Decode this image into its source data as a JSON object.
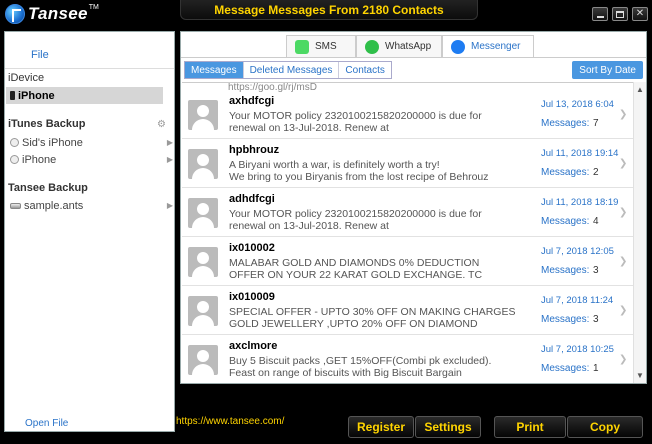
{
  "app": {
    "logo_text": "Tansee",
    "logo_tm": "TM",
    "title": "Message Messages From 2180 Contacts"
  },
  "sidebar": {
    "file_label": "File",
    "idevice_title": "iDevice",
    "iphone_label": "iPhone",
    "itunes_title": "iTunes Backup",
    "backups": [
      "Sid's iPhone",
      "iPhone"
    ],
    "tansee_title": "Tansee Backup",
    "tansee_items": [
      "sample.ants"
    ],
    "open_file": "Open File"
  },
  "tabs": {
    "apps": [
      "SMS",
      "WhatsApp",
      "Messenger"
    ],
    "sub": [
      "Messages",
      "Deleted Messages",
      "Contacts"
    ],
    "sort_label": "Sort By Date"
  },
  "list": {
    "partial_text": "https://goo.gl/rj/msD",
    "messages_label": "Messages:",
    "rows": [
      {
        "sender": "axhdfcgi",
        "line1": "Your MOTOR policy 2320100215820200000 is due for",
        "line2": "renewal on 13-Jul-2018. Renew at",
        "date": "Jul 13, 2018 6:04",
        "count": "7"
      },
      {
        "sender": "hpbhrouz",
        "line1": "A Biryani worth a war, is definitely worth a try!",
        "line2": "We bring to you Biryanis from the lost recipe of Behrouz",
        "date": "Jul 11, 2018 19:14",
        "count": "2"
      },
      {
        "sender": "adhdfcgi",
        "line1": "Your MOTOR policy 2320100215820200000 is due for",
        "line2": "renewal on 13-Jul-2018. Renew at",
        "date": "Jul 11, 2018 18:19",
        "count": "4"
      },
      {
        "sender": "ix010002",
        "line1": "MALABAR GOLD AND DIAMONDS 0% DEDUCTION",
        "line2": "OFFER ON YOUR 22 KARAT GOLD EXCHANGE. TC",
        "date": "Jul 7, 2018 12:05",
        "count": "3"
      },
      {
        "sender": "ix010009",
        "line1": "SPECIAL OFFER - UPTO 30% OFF ON MAKING CHARGES",
        "line2": "GOLD JEWELLERY ,UPTO 20% OFF ON DIAMOND",
        "date": "Jul 7, 2018 11:24",
        "count": "3"
      },
      {
        "sender": "axclmore",
        "line1": "Buy 5 Biscuit packs ,GET 15%OFF(Combi pk excluded).",
        "line2": "Feast on range of biscuits with Big Biscuit Bargain",
        "date": "Jul 7, 2018 10:25",
        "count": "1"
      }
    ]
  },
  "footer": {
    "url": "https://www.tansee.com/",
    "buttons": [
      "Register",
      "Settings",
      "Print",
      "Copy"
    ]
  },
  "colors": {
    "accent_blue": "#2a73c8",
    "button_blue": "#4a97e0",
    "title_yellow": "#ffd400"
  }
}
